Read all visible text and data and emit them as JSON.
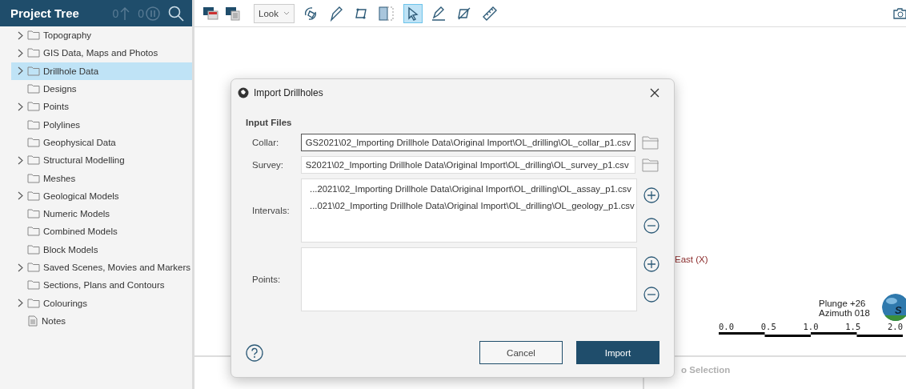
{
  "project_tree": {
    "title": "Project Tree",
    "counters": [
      "0",
      "0"
    ],
    "items": [
      {
        "label": "Topography",
        "kind": "folder",
        "has_children": true,
        "selected": false
      },
      {
        "label": "GIS Data, Maps and Photos",
        "kind": "folder",
        "has_children": true,
        "selected": false
      },
      {
        "label": "Drillhole Data",
        "kind": "folder",
        "has_children": true,
        "selected": true
      },
      {
        "label": "Designs",
        "kind": "folder",
        "has_children": false,
        "selected": false
      },
      {
        "label": "Points",
        "kind": "folder",
        "has_children": true,
        "selected": false
      },
      {
        "label": "Polylines",
        "kind": "folder",
        "has_children": false,
        "selected": false
      },
      {
        "label": "Geophysical Data",
        "kind": "folder",
        "has_children": false,
        "selected": false
      },
      {
        "label": "Structural Modelling",
        "kind": "folder",
        "has_children": true,
        "selected": false
      },
      {
        "label": "Meshes",
        "kind": "folder",
        "has_children": false,
        "selected": false
      },
      {
        "label": "Geological Models",
        "kind": "folder",
        "has_children": true,
        "selected": false
      },
      {
        "label": "Numeric Models",
        "kind": "folder",
        "has_children": false,
        "selected": false
      },
      {
        "label": "Combined Models",
        "kind": "folder",
        "has_children": false,
        "selected": false
      },
      {
        "label": "Block Models",
        "kind": "folder",
        "has_children": false,
        "selected": false
      },
      {
        "label": "Saved Scenes, Movies and Markers",
        "kind": "folder",
        "has_children": true,
        "selected": false
      },
      {
        "label": "Sections, Plans and Contours",
        "kind": "folder",
        "has_children": false,
        "selected": false
      },
      {
        "label": "Colourings",
        "kind": "folder",
        "has_children": true,
        "selected": false
      },
      {
        "label": "Notes",
        "kind": "note",
        "has_children": false,
        "selected": false
      }
    ]
  },
  "toolbar": {
    "view_mode": "Look",
    "tools": [
      {
        "kind": "rotate",
        "selected": false
      },
      {
        "kind": "pencil",
        "selected": false
      },
      {
        "kind": "polygon",
        "selected": false
      },
      {
        "kind": "slice",
        "selected": false
      },
      {
        "kind": "select",
        "selected": true
      },
      {
        "kind": "draw-line",
        "selected": false
      },
      {
        "kind": "edit-polygon",
        "selected": false
      },
      {
        "kind": "ruler",
        "selected": false
      }
    ]
  },
  "scene": {
    "axis_label": "East (X)",
    "plunge": "Plunge +26",
    "azimuth": "Azimuth 018",
    "compass_letter": "S",
    "scale_labels": [
      "0.0",
      "0.5",
      "1.0",
      "1.5",
      "2.0"
    ],
    "selection_panel": "o Selection"
  },
  "dialog": {
    "title": "Import Drillholes",
    "section": "Input Files",
    "collar": {
      "label": "Collar:",
      "value": "GS2021\\02_Importing Drillhole Data\\Original Import\\OL_drilling\\OL_collar_p1.csv"
    },
    "survey": {
      "label": "Survey:",
      "value": "S2021\\02_Importing Drillhole Data\\Original Import\\OL_drilling\\OL_survey_p1.csv"
    },
    "intervals": {
      "label": "Intervals:",
      "files": [
        "...2021\\02_Importing Drillhole Data\\Original Import\\OL_drilling\\OL_assay_p1.csv",
        "...021\\02_Importing Drillhole Data\\Original Import\\OL_drilling\\OL_geology_p1.csv"
      ]
    },
    "points": {
      "label": "Points:"
    },
    "buttons": {
      "cancel": "Cancel",
      "import": "Import"
    }
  }
}
